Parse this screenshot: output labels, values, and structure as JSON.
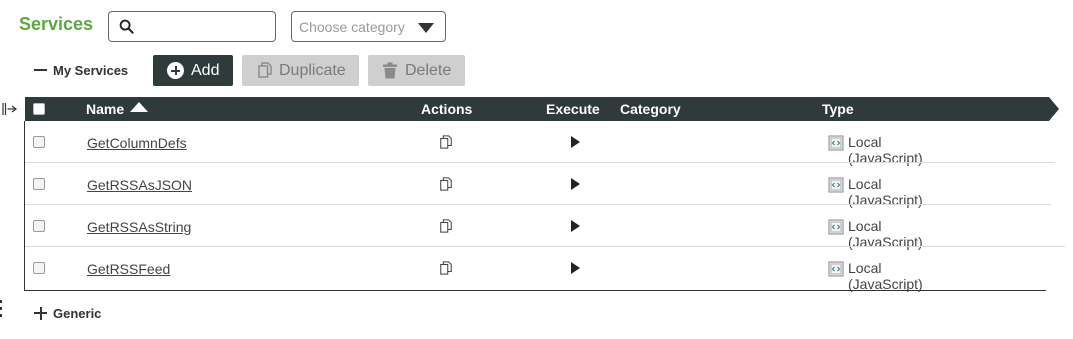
{
  "header": {
    "title": "Services"
  },
  "search": {
    "value": "",
    "placeholder": ""
  },
  "category_filter": {
    "placeholder": "Choose category"
  },
  "my_services": {
    "label": "My Services"
  },
  "toolbar": {
    "add_label": "Add",
    "duplicate_label": "Duplicate",
    "delete_label": "Delete"
  },
  "table": {
    "columns": {
      "name": "Name",
      "actions": "Actions",
      "execute": "Execute",
      "category": "Category",
      "type": "Type"
    },
    "sort": {
      "column": "Name",
      "direction": "ascending"
    },
    "rows": [
      {
        "name": "GetColumnDefs",
        "category": "",
        "type": "Local (JavaScript)"
      },
      {
        "name": "GetRSSAsJSON",
        "category": "",
        "type": "Local (JavaScript)"
      },
      {
        "name": "GetRSSAsString",
        "category": "",
        "type": "Local (JavaScript)"
      },
      {
        "name": "GetRSSFeed",
        "category": "",
        "type": "Local (JavaScript)"
      }
    ]
  },
  "generic": {
    "label": "Generic"
  },
  "colors": {
    "accent": "#5aaa3c",
    "header_bar": "#2f3b3b",
    "disabled_button": "#cfcfcf"
  }
}
